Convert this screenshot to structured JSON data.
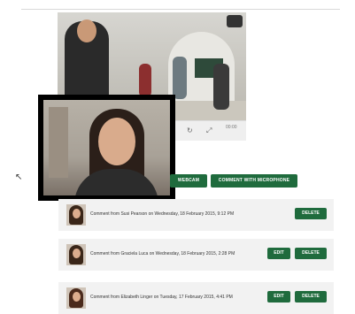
{
  "player": {
    "time": "00:00"
  },
  "actions": {
    "webcam_label": "WEBCAM",
    "microphone_label": "COMMENT WITH MICROPHONE"
  },
  "comments": [
    {
      "text": "Comment from Susi Pearson on Wednesday, 18 February 2015, 9:12 PM",
      "delete_label": "DELETE"
    },
    {
      "text": "Comment from Graciela Luca on Wednesday, 18 February 2015, 2:28 PM",
      "edit_label": "EDIT",
      "delete_label": "DELETE"
    },
    {
      "text": "Comment from Elizabeth Linger on Tuesday, 17 February 2015, 4:41 PM",
      "edit_label": "EDIT",
      "delete_label": "DELETE"
    }
  ],
  "colors": {
    "button": "#1f6b3d",
    "card": "#f2f2f2"
  }
}
